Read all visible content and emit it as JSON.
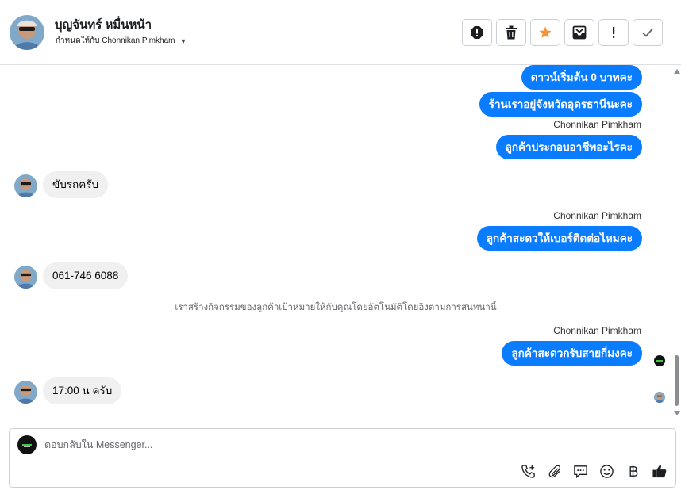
{
  "header": {
    "name": "บุญจันทร์ หมื่นหน้า",
    "assigned_label": "กำหนดให้กับ Chonnikan Pimkham",
    "actions": [
      "spam-icon",
      "trash-icon",
      "star-icon",
      "archive-icon",
      "flag-icon",
      "check-icon"
    ]
  },
  "thread": {
    "messages": [
      {
        "dir": "out",
        "text": "ดาวน์เริ่มต้น 0 บาทคะ"
      },
      {
        "dir": "out",
        "text": "ร้านเราอยู่จังหวัดอุดรธานีนะคะ"
      },
      {
        "dir": "out",
        "sender": "Chonnikan Pimkham",
        "text": "ลูกค้าประกอบอาชีพอะไรคะ"
      },
      {
        "dir": "in",
        "text": "ขับรถครับ"
      },
      {
        "dir": "out",
        "sender": "Chonnikan Pimkham",
        "text": "ลูกค้าสะดวให้เบอร์ติดต่อไหมคะ"
      },
      {
        "dir": "in",
        "text": "061-746 6088"
      },
      {
        "dir": "system",
        "text": "เราสร้างกิจกรรมของลูกค้าเป้าหมายให้กับคุณโดยอัตโนมัติโดยอิงตามการสนทนานี้"
      },
      {
        "dir": "out",
        "sender": "Chonnikan Pimkham",
        "text": "ลูกค้าสะดวกรับสายกี่มงคะ"
      },
      {
        "dir": "in",
        "text": "17:00 น ครับ"
      }
    ]
  },
  "composer": {
    "placeholder": "ตอบกลับใน Messenger...",
    "tools": [
      "call-add-icon",
      "paperclip-icon",
      "saved-reply-icon",
      "emoji-icon",
      "baht-icon",
      "thumbs-up-icon"
    ]
  },
  "colors": {
    "outgoing_bubble": "#0a7cff",
    "incoming_bubble": "#f0f0f0",
    "star": "#f7923a"
  }
}
